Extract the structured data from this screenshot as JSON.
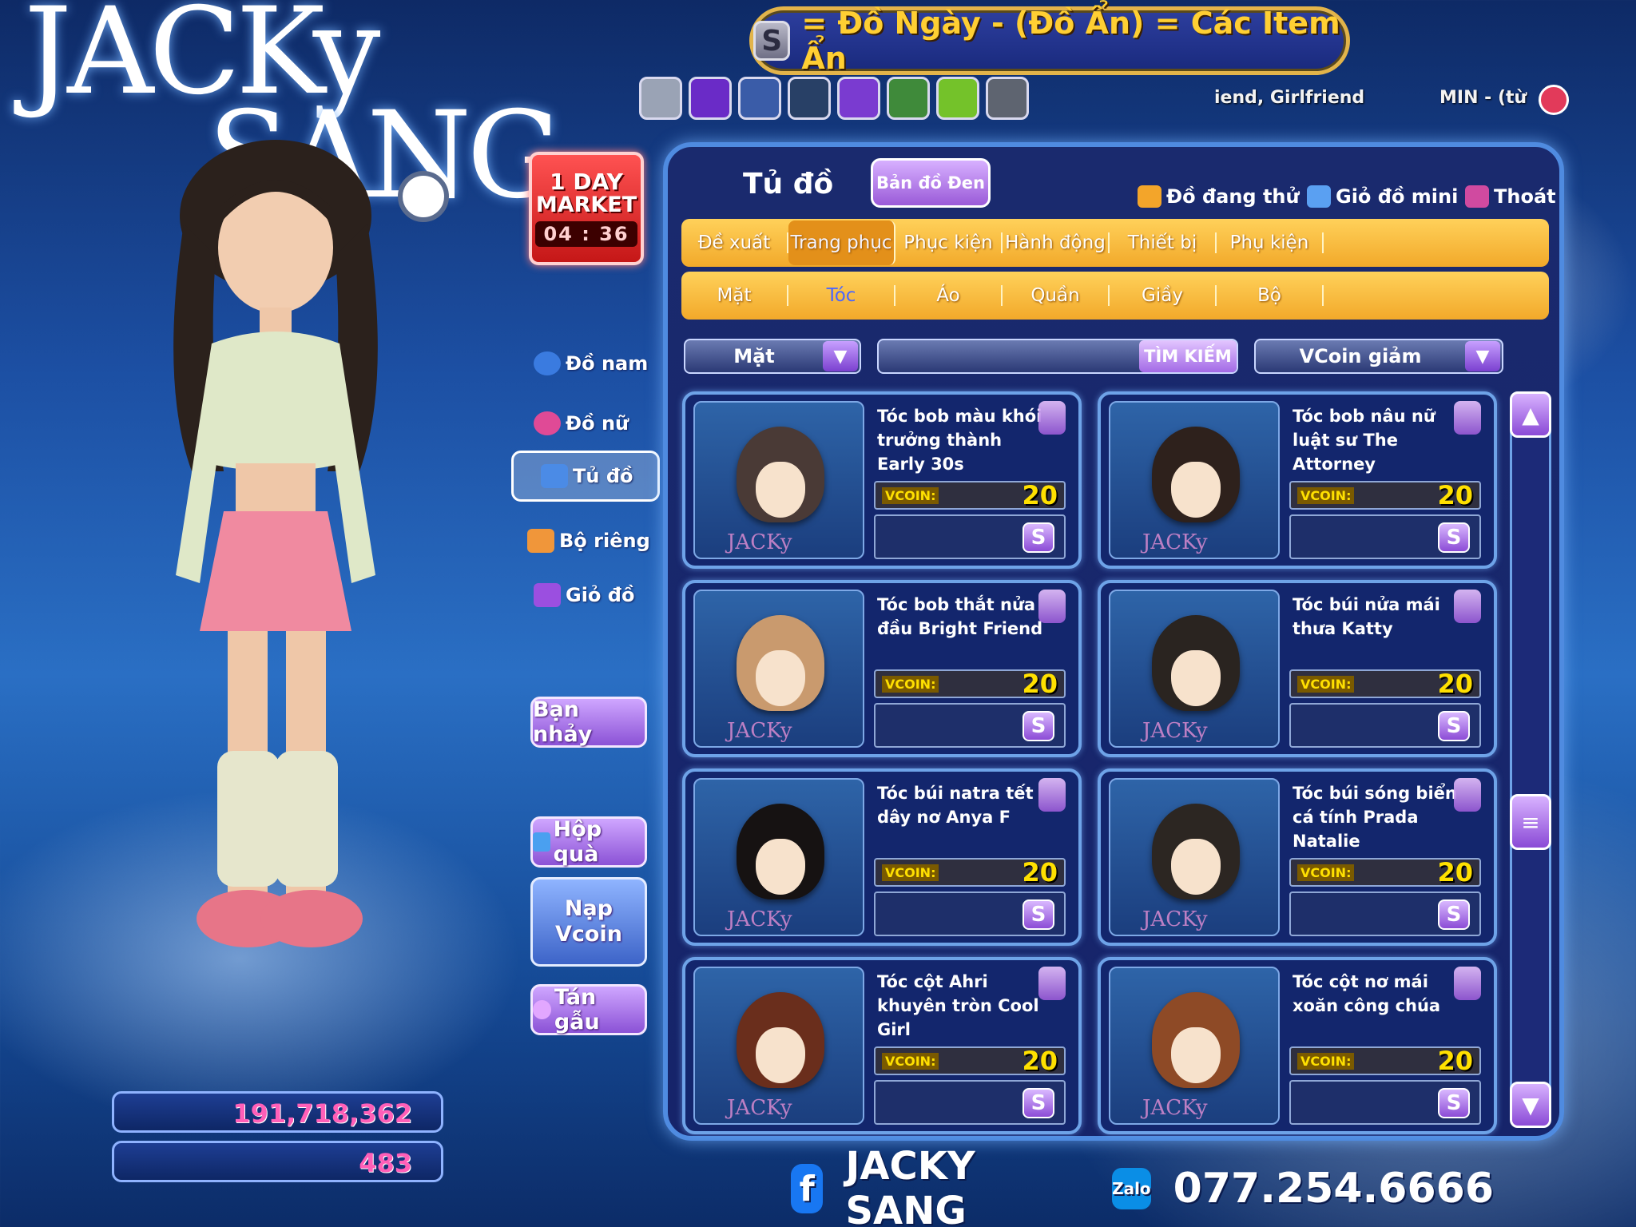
{
  "logo": {
    "line1": "JACKy",
    "line2": "SANG"
  },
  "banner": {
    "badge": "S",
    "text": "= Đồ Ngày - (Đồ Ẩn) = Các Item Ẩn"
  },
  "top": {
    "friend_text": "iend, Girlfriend",
    "min_text": "MIN - (từ"
  },
  "market": {
    "line1": "1 DAY",
    "line2": "MARKET",
    "timer": "04 : 36"
  },
  "left_menu": {
    "do_nam": "Đồ nam",
    "do_nu": "Đồ nữ",
    "tu_do": "Tủ đồ",
    "bo_rieng": "Bộ riêng",
    "gio_do": "Giỏ đồ",
    "ban_nhay": "Bạn nhảy",
    "hop_qua": "Hộp quà",
    "nap_vcoin_1": "Nạp",
    "nap_vcoin_2": "Vcoin",
    "tan_gau": "Tán gẫu"
  },
  "money": {
    "gold": "191,718,362",
    "vcoin": "483"
  },
  "panel": {
    "title": "Tủ đồ",
    "ban_do_den": "Bản đồ Đen",
    "do_dang_thu": "Đồ đang thử",
    "gio_do_mini": "Giỏ đồ mini",
    "thoat": "Thoát"
  },
  "tabs_main": [
    "Đề xuất",
    "Trang phục",
    "Phục kiện",
    "Hành động",
    "Thiết bị",
    "Phụ kiện",
    "",
    ""
  ],
  "tabs_sub": [
    "Mặt",
    "Tóc",
    "Áo",
    "Quần",
    "Giầy",
    "Bộ",
    "",
    ""
  ],
  "filter": {
    "left_select": "Mặt",
    "search_button": "TÌM KIẾM",
    "sort_select": "VCoin giảm"
  },
  "items": [
    {
      "name": "Tóc bob màu khói trưởng thành Early 30s",
      "vcoin_label": "VCOIN:",
      "price": "20",
      "s": "S",
      "hair_color": "#4a3a36"
    },
    {
      "name": "Tóc bob nâu nữ luật sư The Attorney",
      "vcoin_label": "VCOIN:",
      "price": "20",
      "s": "S",
      "hair_color": "#2e211c"
    },
    {
      "name": "Tóc bob thắt nửa đầu Bright Friend",
      "vcoin_label": "VCOIN:",
      "price": "20",
      "s": "S",
      "hair_color": "#c99a6e"
    },
    {
      "name": "Tóc búi nửa mái thưa Katty",
      "vcoin_label": "VCOIN:",
      "price": "20",
      "s": "S",
      "hair_color": "#2a2420"
    },
    {
      "name": "Tóc búi natra tết dây nơ Anya F",
      "vcoin_label": "VCOIN:",
      "price": "20",
      "s": "S",
      "hair_color": "#161212"
    },
    {
      "name": "Tóc búi sóng biển cá tính Prada Natalie",
      "vcoin_label": "VCOIN:",
      "price": "20",
      "s": "S",
      "hair_color": "#2c2622"
    },
    {
      "name": "Tóc cột Ahri khuyên tròn Cool Girl",
      "vcoin_label": "VCOIN:",
      "price": "20",
      "s": "S",
      "hair_color": "#6a2e1c"
    },
    {
      "name": "Tóc cột nơ mái xoăn công chúa",
      "vcoin_label": "VCOIN:",
      "price": "20",
      "s": "S",
      "hair_color": "#8e4a26"
    }
  ],
  "footer": {
    "fb_name": "JACKY SANG",
    "zalo_label": "Zalo",
    "phone": "077.254.6666"
  },
  "colors": {
    "accent_gold": "#ffcf33",
    "panel_bg": "#1a2a6e",
    "tab_orange": "#f2a92a",
    "purple_button": "#9a5ad8"
  },
  "icons": [
    "search-icon",
    "lock-icon",
    "scroll-up-icon",
    "scroll-down-icon",
    "menu-icon",
    "facebook-icon",
    "zalo-icon",
    "user-circle-icon"
  ]
}
